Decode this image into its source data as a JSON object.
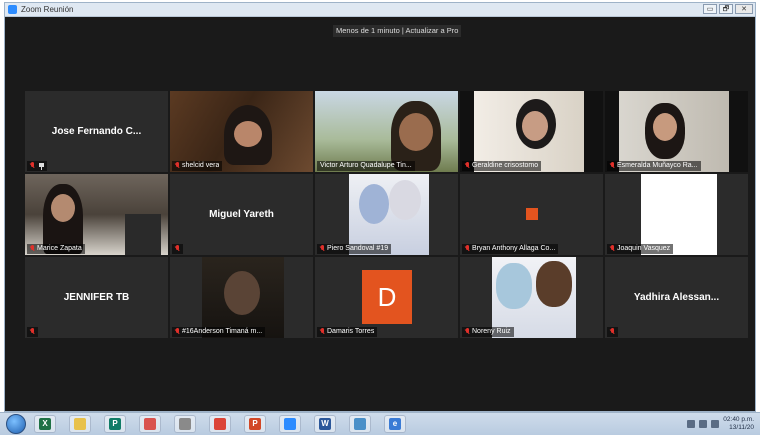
{
  "window": {
    "title": "Zoom Reunión",
    "buttons": [
      "▭",
      "🗗",
      "✕"
    ]
  },
  "notice": "Menos de 1 minuto | Actualizar a Pro",
  "participants": [
    {
      "name": "Jose Fernando C...",
      "display": "Jose Fernando C..."
    },
    {
      "name": "shelcid vera"
    },
    {
      "name": "Victor Arturo Quadalupe Tin..."
    },
    {
      "name": "Geraldine crisostomo"
    },
    {
      "name": "Esmeralda Muñayco Ra..."
    },
    {
      "name": "Marice Zapata"
    },
    {
      "name": "Miguel Yareth",
      "display": "Miguel Yareth"
    },
    {
      "name": "Piero Sandoval #19"
    },
    {
      "name": "Bryan Anthony Allaga Co..."
    },
    {
      "name": "Joaquin Vasquez"
    },
    {
      "name": "JENNIFER TB",
      "display": "JENNIFER TB"
    },
    {
      "name": "#16Anderson Timaná m..."
    },
    {
      "name": "Damaris Torres",
      "avatar_letter": "D"
    },
    {
      "name": "Noreny Ruiz"
    },
    {
      "name": "Yadhira Alessan...",
      "display": "Yadhira Alessan..."
    }
  ],
  "taskbar": {
    "apps": [
      {
        "icon": "excel-icon",
        "glyph": "X",
        "color": "#1e7145"
      },
      {
        "icon": "file-explorer-icon",
        "glyph": "",
        "color": "#e8c14a"
      },
      {
        "icon": "publisher-icon",
        "glyph": "P",
        "color": "#107c67"
      },
      {
        "icon": "paint-icon",
        "glyph": "",
        "color": "#d9534f"
      },
      {
        "icon": "tools-icon",
        "glyph": "",
        "color": "#8a8a8a"
      },
      {
        "icon": "chrome-icon",
        "glyph": "",
        "color": "#db4437"
      },
      {
        "icon": "powerpoint-icon",
        "glyph": "P",
        "color": "#d24726"
      },
      {
        "icon": "zoom-icon",
        "glyph": "",
        "color": "#2d8cff"
      },
      {
        "icon": "word-icon",
        "glyph": "W",
        "color": "#2b579a"
      },
      {
        "icon": "media-icon",
        "glyph": "",
        "color": "#4a90c8"
      },
      {
        "icon": "ie-icon",
        "glyph": "e",
        "color": "#3a7bd5"
      }
    ],
    "time": "02:40 p.m.",
    "date": "13/11/20"
  }
}
